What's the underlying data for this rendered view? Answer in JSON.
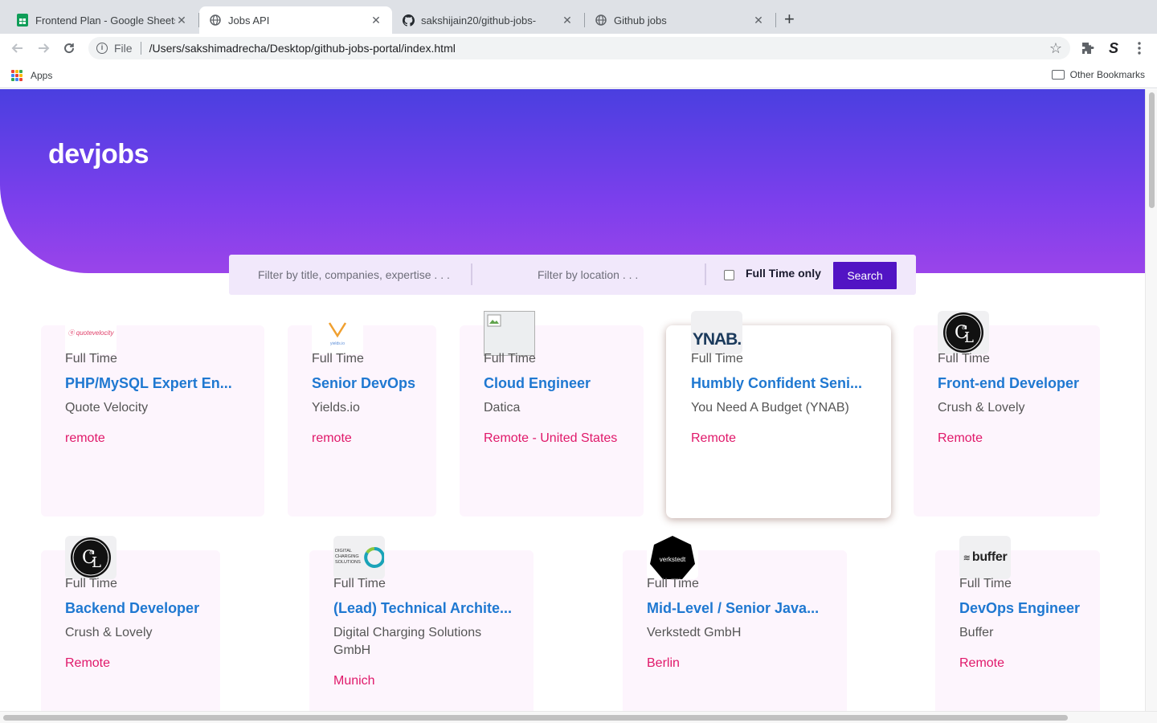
{
  "browser": {
    "tabs": [
      {
        "title": "Frontend Plan - Google Sheets",
        "icon": "sheets-icon"
      },
      {
        "title": "Jobs API",
        "icon": "globe-icon"
      },
      {
        "title": "sakshijain20/github-jobs-",
        "icon": "github-icon"
      },
      {
        "title": "Github jobs",
        "icon": "globe-icon"
      }
    ],
    "address": {
      "scheme_label": "File",
      "url": "/Users/sakshimadrecha/Desktop/github-jobs-portal/index.html"
    },
    "bookmarks": {
      "apps_label": "Apps",
      "other_label": "Other Bookmarks"
    },
    "colors": {
      "tab_strip": "#dee1e6",
      "sheets_green": "#0f9d58"
    }
  },
  "page": {
    "logo": "devjobs",
    "filters": {
      "title_placeholder": "Filter by title, companies, expertise . . .",
      "location_placeholder": "Filter by location . . .",
      "fulltime_label": "Full Time only",
      "fulltime_checked": false,
      "search_label": "Search"
    },
    "colors": {
      "hero_start": "#4a3fe0",
      "hero_end": "#9a44ea",
      "title": "#1f78d1",
      "location": "#e0186a",
      "search_button": "#5214c4"
    },
    "jobs": [
      {
        "type": "Full Time",
        "title": "PHP/MySQL Expert En...",
        "company": "Quote Velocity",
        "location": "remote",
        "logo": "quotevelocity-logo"
      },
      {
        "type": "Full Time",
        "title": "Senior DevOps",
        "company": "Yields.io",
        "location": "remote",
        "logo": "yields-logo"
      },
      {
        "type": "Full Time",
        "title": "Cloud Engineer",
        "company": "Datica",
        "location": "Remote - United States",
        "logo": "broken-image-icon"
      },
      {
        "type": "Full Time",
        "title": "Humbly Confident Seni...",
        "company": "You Need A Budget (YNAB)",
        "location": "Remote",
        "logo": "ynab-logo",
        "logo_text": "YNAB."
      },
      {
        "type": "Full Time",
        "title": "Front-end Developer",
        "company": "Crush & Lovely",
        "location": "Remote",
        "logo": "crush-lovely-logo"
      },
      {
        "type": "Full Time",
        "title": "Backend Developer",
        "company": "Crush & Lovely",
        "location": "Remote",
        "logo": "crush-lovely-logo"
      },
      {
        "type": "Full Time",
        "title": "(Lead) Technical Archite...",
        "company": "Digital Charging Solutions GmbH",
        "location": "Munich",
        "logo": "dcs-logo"
      },
      {
        "type": "Full Time",
        "title": "Mid-Level / Senior Java...",
        "company": "Verkstedt GmbH",
        "location": "Berlin",
        "logo": "verkstedt-logo"
      },
      {
        "type": "Full Time",
        "title": "DevOps Engineer",
        "company": "Buffer",
        "location": "Remote",
        "logo": "buffer-logo",
        "logo_text": "buffer"
      }
    ]
  }
}
